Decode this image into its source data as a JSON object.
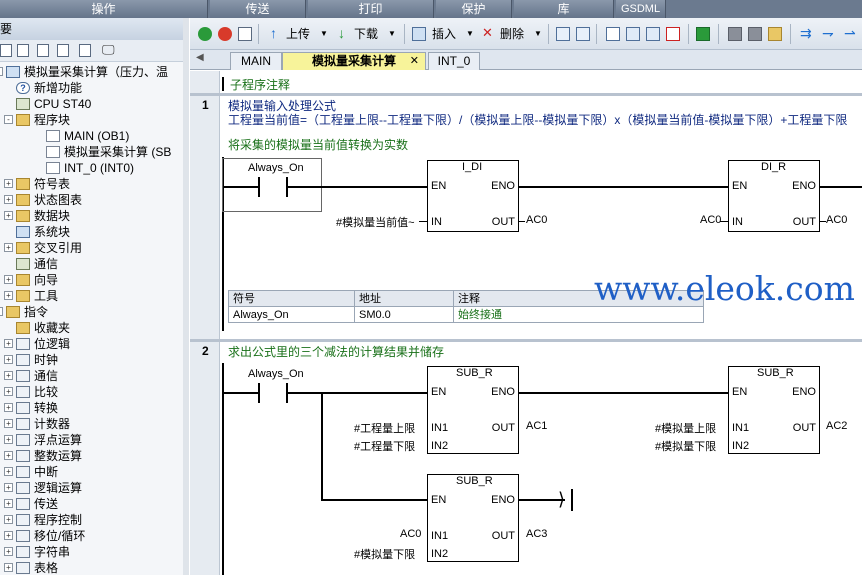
{
  "top_tabs": [
    "操作",
    "传送",
    "打印",
    "保护",
    "库",
    "GSDML"
  ],
  "left_panel": {
    "header": "主要",
    "tree": [
      {
        "label": "模拟量采集计算（压力、温",
        "level": 0,
        "expand": "-",
        "icon": "project"
      },
      {
        "label": "新增功能",
        "level": 1,
        "icon": "help"
      },
      {
        "label": "CPU ST40",
        "level": 1,
        "icon": "cpu"
      },
      {
        "label": "程序块",
        "level": 1,
        "expand": "-",
        "icon": "folder"
      },
      {
        "label": "MAIN (OB1)",
        "level": 2,
        "icon": "doc"
      },
      {
        "label": "模拟量采集计算 (SB",
        "level": 2,
        "icon": "doc"
      },
      {
        "label": "INT_0 (INT0)",
        "level": 2,
        "icon": "doc"
      },
      {
        "label": "符号表",
        "level": 1,
        "expand": "+",
        "icon": "folder"
      },
      {
        "label": "状态图表",
        "level": 1,
        "expand": "+",
        "icon": "folder"
      },
      {
        "label": "数据块",
        "level": 1,
        "expand": "+",
        "icon": "folder"
      },
      {
        "label": "系统块",
        "level": 1,
        "icon": "blue"
      },
      {
        "label": "交叉引用",
        "level": 1,
        "expand": "+",
        "icon": "folder"
      },
      {
        "label": "通信",
        "level": 1,
        "icon": "cpu"
      },
      {
        "label": "向导",
        "level": 1,
        "expand": "+",
        "icon": "folder"
      },
      {
        "label": "工具",
        "level": 1,
        "expand": "+",
        "icon": "folder"
      },
      {
        "label": "指令",
        "level": 0,
        "expand": "-",
        "icon": "folder"
      },
      {
        "label": "收藏夹",
        "level": 1,
        "icon": "folder"
      },
      {
        "label": "位逻辑",
        "level": 1,
        "expand": "+",
        "icon": "instr"
      },
      {
        "label": "时钟",
        "level": 1,
        "expand": "+",
        "icon": "instr"
      },
      {
        "label": "通信",
        "level": 1,
        "expand": "+",
        "icon": "instr"
      },
      {
        "label": "比较",
        "level": 1,
        "expand": "+",
        "icon": "instr"
      },
      {
        "label": "转换",
        "level": 1,
        "expand": "+",
        "icon": "instr"
      },
      {
        "label": "计数器",
        "level": 1,
        "expand": "+",
        "icon": "instr"
      },
      {
        "label": "浮点运算",
        "level": 1,
        "expand": "+",
        "icon": "instr"
      },
      {
        "label": "整数运算",
        "level": 1,
        "expand": "+",
        "icon": "instr"
      },
      {
        "label": "中断",
        "level": 1,
        "expand": "+",
        "icon": "instr"
      },
      {
        "label": "逻辑运算",
        "level": 1,
        "expand": "+",
        "icon": "instr"
      },
      {
        "label": "传送",
        "level": 1,
        "expand": "+",
        "icon": "instr"
      },
      {
        "label": "程序控制",
        "level": 1,
        "expand": "+",
        "icon": "instr"
      },
      {
        "label": "移位/循环",
        "level": 1,
        "expand": "+",
        "icon": "instr"
      },
      {
        "label": "字符串",
        "level": 1,
        "expand": "+",
        "icon": "instr"
      },
      {
        "label": "表格",
        "level": 1,
        "expand": "+",
        "icon": "instr"
      }
    ]
  },
  "toolbar": {
    "upload": "上传",
    "download": "下载",
    "insert": "插入",
    "delete": "删除"
  },
  "program_tabs": [
    {
      "label": "MAIN",
      "active": false
    },
    {
      "label": "模拟量采集计算",
      "active": true
    },
    {
      "label": "INT_0",
      "active": false
    }
  ],
  "editor": {
    "subroutine_comment": "子程序注释",
    "network1": {
      "number": "1",
      "title": "模拟量输入处理公式",
      "formula": "工程量当前值=（工程量上限--工程量下限）/（模拟量上限--模拟量下限）x（模拟量当前值-模拟量下限）+工程量下限",
      "comment": "将采集的模拟量当前值转换为实数",
      "contact": "Always_On",
      "box1": {
        "name": "I_DI",
        "en": "EN",
        "eno": "ENO",
        "in": "IN",
        "out": "OUT",
        "in_operand": "#模拟量当前值~",
        "out_operand": "AC0"
      },
      "box2": {
        "name": "DI_R",
        "en": "EN",
        "eno": "ENO",
        "in": "IN",
        "out": "OUT",
        "in_operand": "AC0",
        "out_operand": "AC0"
      },
      "symbol_table": {
        "headers": [
          "符号",
          "地址",
          "注释"
        ],
        "row": [
          "Always_On",
          "SM0.0",
          "始终接通"
        ]
      }
    },
    "network2": {
      "number": "2",
      "title": "求出公式里的三个减法的计算结果并储存",
      "contact": "Always_On",
      "box1": {
        "name": "SUB_R",
        "en": "EN",
        "eno": "ENO",
        "in1": "IN1",
        "in2": "IN2",
        "out": "OUT",
        "in1_operand": "#工程量上限",
        "in2_operand": "#工程量下限",
        "out_operand": "AC1"
      },
      "box2": {
        "name": "SUB_R",
        "en": "EN",
        "eno": "ENO",
        "in1": "IN1",
        "in2": "IN2",
        "out": "OUT",
        "in1_operand": "#模拟量上限",
        "in2_operand": "#模拟量下限",
        "out_operand": "AC2"
      },
      "box3": {
        "name": "SUB_R",
        "en": "EN",
        "eno": "ENO",
        "in1": "IN1",
        "in2": "IN2",
        "out": "OUT",
        "in1_operand": "AC0",
        "in2_operand": "#模拟量下限",
        "out_operand": "AC3"
      }
    }
  },
  "watermark": "www.eleok.com"
}
